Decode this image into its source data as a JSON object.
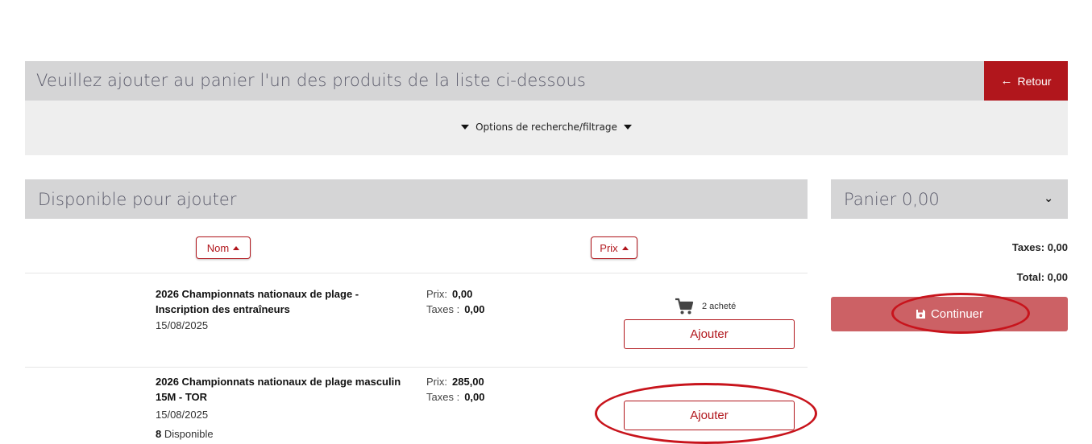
{
  "header": {
    "title": "Veuillez ajouter au panier l'un des produits de la liste ci-dessous",
    "back_label": "Retour"
  },
  "filter": {
    "label": "Options de recherche/filtrage"
  },
  "available": {
    "title": "Disponible pour ajouter",
    "sort_name_label": "Nom",
    "sort_price_label": "Prix",
    "products": [
      {
        "year": "2026",
        "name": "Championnats nationaux de plage - Inscription des entraîneurs",
        "date": "15/08/2025",
        "price_label": "Prix:",
        "price": "0,00",
        "taxes_label": "Taxes :",
        "taxes": "0,00",
        "bought": "2 acheté",
        "add_label": "Ajouter"
      },
      {
        "year": "2026",
        "name": "Championnats nationaux de plage masculin 15M - TOR",
        "date": "15/08/2025",
        "price_label": "Prix:",
        "price": "285,00",
        "taxes_label": "Taxes :",
        "taxes": "0,00",
        "available_count": "8",
        "available_label": "Disponible",
        "add_label": "Ajouter"
      }
    ]
  },
  "cart": {
    "title": "Panier 0,00",
    "taxes": "Taxes: 0,00",
    "total": "Total: 0,00",
    "continue_label": "Continuer"
  },
  "colors": {
    "accent": "#b1161c",
    "header_bg": "#d5d5d6",
    "continue_bg": "#cc6165"
  },
  "icons": [
    "arrow-left-icon",
    "caret-down-icon",
    "caret-up-icon",
    "cart-icon",
    "chevron-down-icon",
    "save-icon"
  ]
}
